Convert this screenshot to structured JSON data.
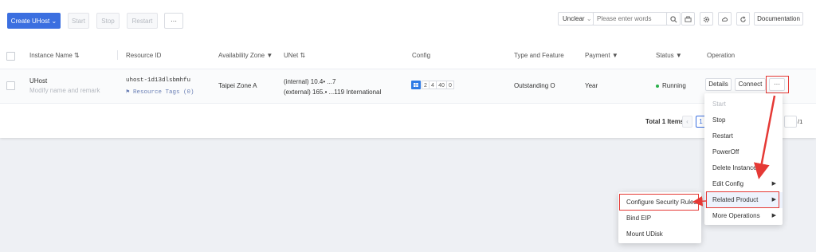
{
  "toolbar": {
    "create_label": "Create UHost",
    "start_label": "Start",
    "stop_label": "Stop",
    "restart_label": "Restart",
    "more_label": "···",
    "filter_select": "Unclear",
    "search_placeholder": "Please enter words",
    "documentation_label": "Documentation"
  },
  "table": {
    "headers": [
      "Instance Name",
      "Resource ID",
      "Availability Zone",
      "UNet",
      "Config",
      "Type and Feature",
      "Payment",
      "Status",
      "Operation"
    ],
    "row": {
      "name": "UHost",
      "name_hint": "Modify name and remark",
      "resource_id": "uhost-1d13dlsbmhfu",
      "resource_tags": "Resource Tags (0)",
      "zone": "Taipei Zone A",
      "internal_ip": "(internal) 10.4• ...7",
      "external_ip": "(external) 165.• ...119 International",
      "config": [
        "2",
        "4",
        "40",
        "0"
      ],
      "type": "Outstanding O",
      "payment": "Year",
      "status": "Running",
      "details_label": "Details",
      "connect_label": "Connect",
      "more_label": "···"
    }
  },
  "footer": {
    "total": "Total 1 Items",
    "page": "1",
    "pages": "/1"
  },
  "op_menu": {
    "items": [
      "Start",
      "Stop",
      "Restart",
      "PowerOff",
      "Delete Instance",
      "Edit Config",
      "Related Product",
      "More Operations"
    ]
  },
  "sub_menu": {
    "items": [
      "Configure Security Rules",
      "Bind EIP",
      "Mount UDisk"
    ]
  },
  "colors": {
    "primary": "#3b6fe0",
    "running": "#2ab04a",
    "highlight": "#e53935"
  }
}
